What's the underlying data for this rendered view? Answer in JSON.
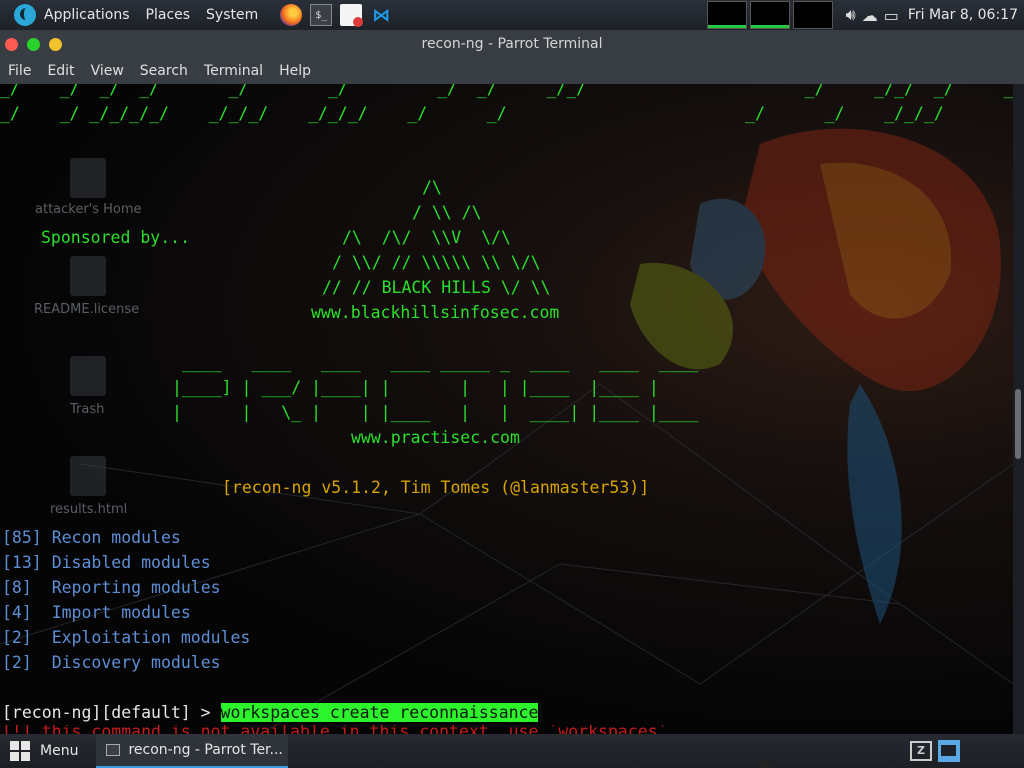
{
  "top_panel": {
    "applications": "Applications",
    "places": "Places",
    "system": "System",
    "clock": "Fri Mar  8, 06:17"
  },
  "window": {
    "title": "recon-ng - Parrot Terminal"
  },
  "menubar": [
    "File",
    "Edit",
    "View",
    "Search",
    "Terminal",
    "Help"
  ],
  "terminal": {
    "banner_top_1": "_/    _/  _/  _/       _/        _/         _/  _/     _/_/                      _/     _/_/  _/     _/",
    "banner_top_2": "_/    _/ _/_/_/_/    _/_/_/    _/_/_/    _/      _/                        _/      _/    _/_/_/",
    "sponsored": "Sponsored by...",
    "bhis_1": "/\\",
    "bhis_2": "/ \\\\ /\\",
    "bhis_3": "/\\  /\\/  \\\\V  \\/\\",
    "bhis_4": "/ \\\\/ // \\\\\\\\\\ \\\\ \\/\\",
    "bhis_5": "// // BLACK HILLS \\/ \\\\",
    "bhis_url": "www.blackhillsinfosec.com",
    "ps_1": " ____   ____   ____   ____ _____ _  ____   ____  ____",
    "ps_2": "|____] | ___/ |____| |       |   | |____  |____ |",
    "ps_3": "|      |   \\_ |    | |____   |   |  ____| |____ |____",
    "ps_url": "www.practisec.com",
    "version": "[recon-ng v5.1.2, Tim Tomes (@lanmaster53)]",
    "modules": [
      {
        "count": "[85]",
        "label": "Recon modules"
      },
      {
        "count": "[13]",
        "label": "Disabled modules"
      },
      {
        "count": "[8]",
        "label": "Reporting modules"
      },
      {
        "count": "[4]",
        "label": "Import modules"
      },
      {
        "count": "[2]",
        "label": "Exploitation modules"
      },
      {
        "count": "[2]",
        "label": "Discovery modules"
      }
    ],
    "prompt": "[recon-ng][default] > ",
    "command": "workspaces create reconnaissance",
    "partial_line": "[!] this command is not available in this context, use `workspaces` ..."
  },
  "desktop_icons": [
    "attacker's Home",
    "README.license",
    "Trash",
    "results.html"
  ],
  "taskbar": {
    "menu": "Menu",
    "task": "recon-ng - Parrot Ter..."
  },
  "colors": {
    "accent_green": "#2be02b",
    "orange": "#d9a400",
    "module_blue": "#5e8fd6",
    "highlight": "#2cf32c"
  }
}
